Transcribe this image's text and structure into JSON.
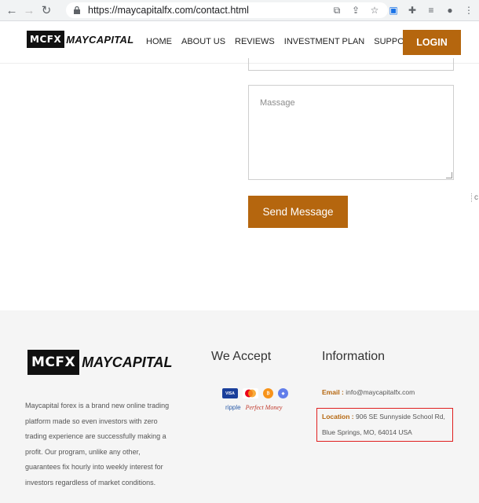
{
  "browser": {
    "url": "https://maycapitalfx.com/contact.html"
  },
  "header": {
    "logo_box": "MCFX",
    "logo_name": "MAYCAPITAL",
    "nav": [
      "HOME",
      "ABOUT US",
      "REVIEWS",
      "INVESTMENT PLAN",
      "SUPPORT"
    ],
    "login_label": "LOGIN"
  },
  "form": {
    "message_placeholder": "Massage",
    "send_label": "Send Message"
  },
  "footer": {
    "logo_box": "MCFX",
    "logo_name": "MAYCAPITAL",
    "about_lines": [
      "Maycapital forex is a brand new online trading",
      "platform made so even investors with zero",
      "trading experience are successfully making a",
      "profit. Our program, unlike any other,",
      "guarantees fix hourly into weekly interest for",
      "investors regardless of market conditions."
    ],
    "accept_title": "We Accept",
    "payment_row1": [
      "VISA",
      "MC",
      "BTC",
      "ETH"
    ],
    "payment_row2": [
      "ripple",
      "Perfect Money"
    ],
    "info_title": "Information",
    "email_label": "Email :",
    "email_value": "info@maycapitalfx.com",
    "location_label": "Location :",
    "location_line1": "906 SE Sunnyside School Rd,",
    "location_line2": "Blue Springs, MO, 64014 USA"
  },
  "colors": {
    "accent": "#b5660e",
    "highlight": "#e02020"
  }
}
